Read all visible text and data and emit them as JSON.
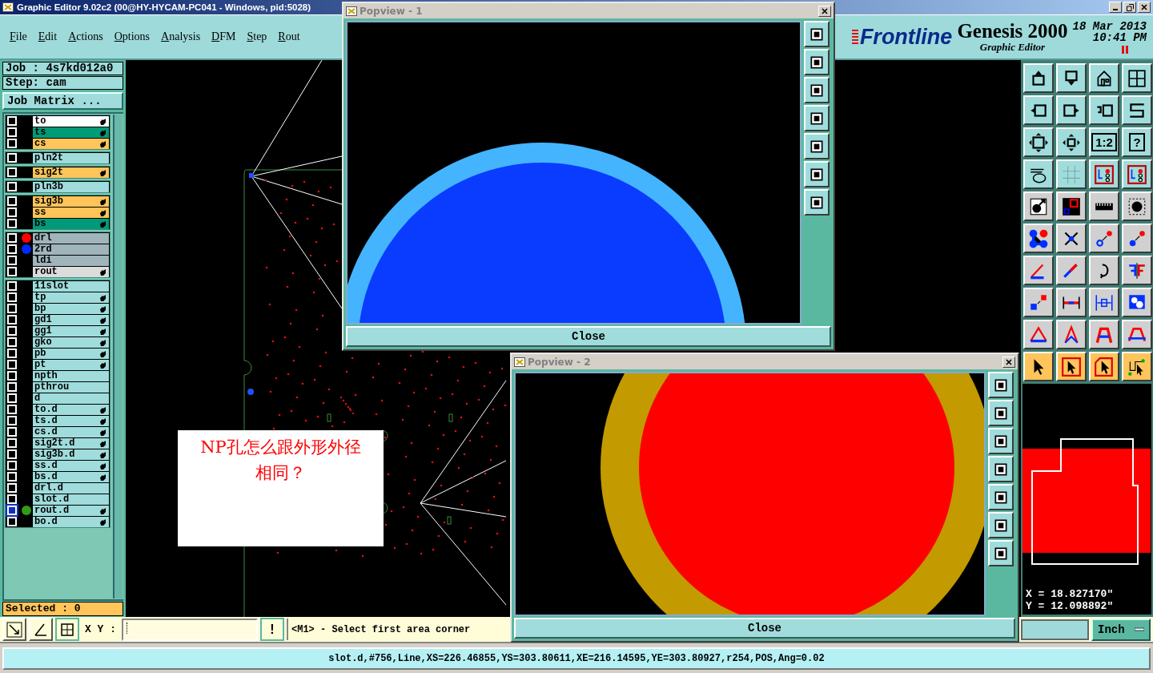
{
  "window": {
    "title": "Graphic Editor 9.02c2 (00@HY-HYCAM-PC041 - Windows, pid:5028)"
  },
  "menu": [
    "File",
    "Edit",
    "Actions",
    "Options",
    "Analysis",
    "DFM",
    "Step",
    "Rout"
  ],
  "brand": {
    "logo": "Frontline",
    "product": "Genesis 2000",
    "subtitle": "Graphic Editor",
    "date": "18 Mar 2013",
    "time": "10:41 PM"
  },
  "job": "Job : 4s7kd012a0",
  "step": "Step: cam",
  "job_matrix_button": "Job Matrix ...",
  "layer_groups": [
    [
      {
        "name": "to",
        "color": "#ffffff",
        "editable": true,
        "selected": false
      },
      {
        "name": "ts",
        "color": "#009a78",
        "editable": true,
        "selected": false
      },
      {
        "name": "cs",
        "color": "#ffc45a",
        "editable": true,
        "selected": false
      }
    ],
    [
      {
        "name": "pln2t",
        "color": "#a0dcdc",
        "editable": false,
        "selected": false
      }
    ],
    [
      {
        "name": "sig2t",
        "color": "#ffc45a",
        "editable": true,
        "selected": false
      }
    ],
    [
      {
        "name": "pln3b",
        "color": "#a0dcdc",
        "editable": false,
        "selected": false
      }
    ],
    [
      {
        "name": "sig3b",
        "color": "#ffc45a",
        "editable": true,
        "selected": false
      },
      {
        "name": "ss",
        "color": "#ffc45a",
        "editable": true,
        "selected": false
      },
      {
        "name": "bs",
        "color": "#009a78",
        "editable": true,
        "selected": false
      }
    ],
    [
      {
        "name": "drl",
        "color": "#a0b4bc",
        "editable": false,
        "selected": false,
        "dot": {
          "color": "#ff0000"
        }
      },
      {
        "name": "2rd",
        "color": "#a0b4bc",
        "editable": false,
        "selected": false,
        "dot": {
          "color": "#0028ff"
        }
      },
      {
        "name": "ldi",
        "color": "#a0b4bc",
        "editable": false,
        "selected": false
      },
      {
        "name": "rout",
        "color": "#dcdcdc",
        "editable": true,
        "selected": false
      }
    ],
    [
      {
        "name": "11slot",
        "color": "#a0dcdc",
        "editable": false,
        "selected": false
      },
      {
        "name": "tp",
        "color": "#a0dcdc",
        "editable": true,
        "selected": false
      },
      {
        "name": "bp",
        "color": "#a0dcdc",
        "editable": true,
        "selected": false
      },
      {
        "name": "gd1",
        "color": "#a0dcdc",
        "editable": true,
        "selected": false
      },
      {
        "name": "gg1",
        "color": "#a0dcdc",
        "editable": true,
        "selected": false
      },
      {
        "name": "gko",
        "color": "#a0dcdc",
        "editable": true,
        "selected": false
      },
      {
        "name": "pb",
        "color": "#a0dcdc",
        "editable": true,
        "selected": false
      },
      {
        "name": "pt",
        "color": "#a0dcdc",
        "editable": true,
        "selected": false
      },
      {
        "name": "npth",
        "color": "#a0dcdc",
        "editable": false,
        "selected": false
      },
      {
        "name": "pthrou",
        "color": "#a0dcdc",
        "editable": false,
        "selected": false
      },
      {
        "name": "d",
        "color": "#a0dcdc",
        "editable": false,
        "selected": false
      },
      {
        "name": "to.d",
        "color": "#a0dcdc",
        "editable": true,
        "selected": false
      },
      {
        "name": "ts.d",
        "color": "#a0dcdc",
        "editable": true,
        "selected": false
      },
      {
        "name": "cs.d",
        "color": "#a0dcdc",
        "editable": true,
        "selected": false
      },
      {
        "name": "sig2t.d",
        "color": "#a0dcdc",
        "editable": true,
        "selected": false
      },
      {
        "name": "sig3b.d",
        "color": "#a0dcdc",
        "editable": true,
        "selected": false
      },
      {
        "name": "ss.d",
        "color": "#a0dcdc",
        "editable": true,
        "selected": false
      },
      {
        "name": "bs.d",
        "color": "#a0dcdc",
        "editable": true,
        "selected": false
      },
      {
        "name": "drl.d",
        "color": "#a0dcdc",
        "editable": false,
        "selected": false
      },
      {
        "name": "slot.d",
        "color": "#a0dcdc",
        "editable": false,
        "selected": false
      },
      {
        "name": "rout.d",
        "color": "#a0dcdc",
        "editable": true,
        "selected": true,
        "dot": {
          "color": "#329a14"
        }
      },
      {
        "name": "bo.d",
        "color": "#a0dcdc",
        "editable": true,
        "selected": false
      }
    ]
  ],
  "selected_count": "Selected : 0",
  "toolbar_labels": [
    "1:2",
    "?"
  ],
  "coordinates": [
    "X = 18.827170\"",
    "Y = 12.098892\""
  ],
  "note": "NP孔怎么跟外形外径相同？",
  "bottom": {
    "xy_label": "X Y :",
    "alert_button": "!",
    "prompt": "<M1> - Select first area corner",
    "units": "Inch"
  },
  "status": "slot.d,#756,Line,XS=226.46855,YS=303.80611,XE=216.14595,YE=303.80927,r254,POS,Ang=0.02",
  "popviews": [
    {
      "title": "Popview - 1",
      "close": "Close",
      "ring": {
        "color": "#44b4ff"
      },
      "pad": {
        "color": "#0a3cff"
      }
    },
    {
      "title": "Popview - 2",
      "close": "Close",
      "ring": {
        "color": "#c39a00"
      },
      "pad": {
        "color": "#ff0000"
      }
    }
  ]
}
